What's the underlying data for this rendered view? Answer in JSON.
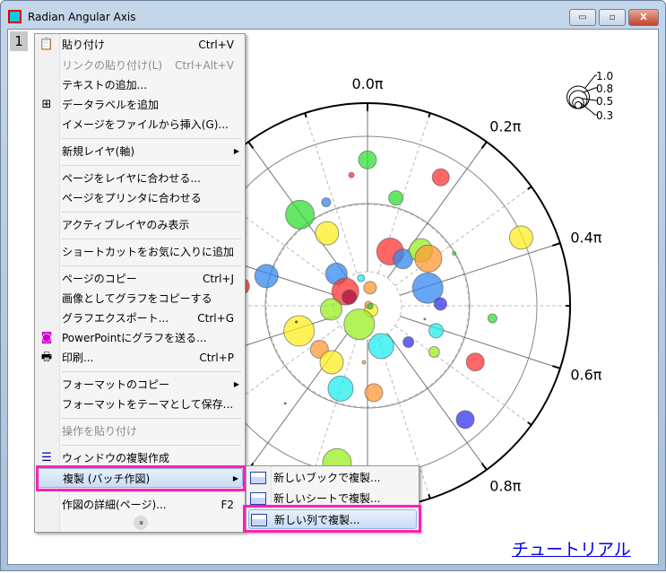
{
  "window": {
    "title": "Radian Angular Axis",
    "layer_label": "1",
    "minimize": "▭",
    "maximize": "▫",
    "close": "X"
  },
  "tutorial_link": "チュートリアル",
  "context_menu": {
    "items": [
      {
        "label": "貼り付け",
        "shortcut": "Ctrl+V",
        "icon": "paste-icon",
        "enabled": true
      },
      {
        "label": "リンクの貼り付け(L)",
        "shortcut": "Ctrl+Alt+V",
        "enabled": false
      },
      {
        "label": "テキストの追加...",
        "enabled": true
      },
      {
        "label": "データラベルを追加",
        "icon": "data-label-icon",
        "enabled": true
      },
      {
        "label": "イメージをファイルから挿入(G)...",
        "enabled": true
      },
      {
        "label": "新規レイヤ(軸)",
        "submenu": true,
        "enabled": true
      },
      {
        "label": "ページをレイヤに合わせる...",
        "enabled": true
      },
      {
        "label": "ページをプリンタに合わせる",
        "enabled": true
      },
      {
        "label": "アクティブレイヤのみ表示",
        "enabled": true
      },
      {
        "label": "ショートカットをお気に入りに追加",
        "enabled": true
      },
      {
        "label": "ページのコピー",
        "shortcut": "Ctrl+J",
        "enabled": true
      },
      {
        "label": "画像としてグラフをコピーする",
        "enabled": true
      },
      {
        "label": "グラフエクスポート...",
        "shortcut": "Ctrl+G",
        "enabled": true
      },
      {
        "label": "PowerPointにグラフを送る...",
        "icon": "powerpoint-icon",
        "enabled": true
      },
      {
        "label": "印刷...",
        "shortcut": "Ctrl+P",
        "icon": "printer-icon",
        "enabled": true
      },
      {
        "label": "フォーマットのコピー",
        "submenu": true,
        "enabled": true
      },
      {
        "label": "フォーマットをテーマとして保存...",
        "enabled": true
      },
      {
        "label": "操作を貼り付け",
        "enabled": false
      },
      {
        "label": "ウィンドウの複製作成",
        "icon": "duplicate-window-icon",
        "enabled": true
      },
      {
        "label": "複製 (バッチ作図)",
        "submenu": true,
        "enabled": true,
        "highlighted": true
      },
      {
        "label": "作図の詳細(ページ)...",
        "shortcut": "F2",
        "enabled": true
      }
    ],
    "more": "»"
  },
  "submenu": {
    "items": [
      {
        "label": "新しいブックで複製...",
        "icon": "new-book-icon"
      },
      {
        "label": "新しいシートで複製...",
        "icon": "new-sheet-icon"
      },
      {
        "label": "新しい列で複製...",
        "icon": "new-column-icon",
        "highlighted": true
      }
    ]
  },
  "colors": {
    "highlight_box": "#ff1fb4",
    "link": "#0000ee"
  },
  "chart_data": {
    "type": "scatter",
    "subtype": "polar-bubble",
    "angle_unit": "π",
    "angle_direction": "clockwise",
    "angle_zero": "top",
    "angle_ticks": [
      "0.0π",
      "0.2π",
      "0.4π",
      "0.6π",
      "0.8π"
    ],
    "angle_tick_values": [
      0,
      0.2,
      0.4,
      0.6,
      0.8
    ],
    "radial_range": [
      0,
      1
    ],
    "grid": true,
    "size_legend": {
      "labels": [
        "1.0",
        "0.8",
        "0.5",
        "0.3"
      ],
      "values": [
        1.0,
        0.8,
        0.5,
        0.3
      ],
      "placement": "top-right"
    },
    "points": [
      {
        "theta": 0,
        "r": 0.72,
        "size": 0.8,
        "color": "#33dd33"
      },
      {
        "theta": 0.165,
        "r": 0.73,
        "size": 0.76,
        "color": "#ff3333"
      },
      {
        "theta": 1.961,
        "r": 0.65,
        "size": 0.24,
        "color": "#ff3333"
      },
      {
        "theta": 0.082,
        "r": 0.55,
        "size": 0.64,
        "color": "#33dd33"
      },
      {
        "theta": 1.879,
        "r": 0.55,
        "size": 0.4,
        "color": "#3388ee"
      },
      {
        "theta": 1.797,
        "r": 0.56,
        "size": 1.28,
        "color": "#33dd33"
      },
      {
        "theta": 1.838,
        "r": 0.41,
        "size": 1.04,
        "color": "#ffee22"
      },
      {
        "theta": 0.367,
        "r": 0.83,
        "size": 1.04,
        "color": "#ffee22"
      },
      {
        "theta": 0.126,
        "r": 0.29,
        "size": 1.2,
        "color": "#ff3333"
      },
      {
        "theta": 0.206,
        "r": 0.29,
        "size": 0.88,
        "color": "#3388ee"
      },
      {
        "theta": 0.244,
        "r": 0.38,
        "size": 1.04,
        "color": "#99ee22"
      },
      {
        "theta": 0.29,
        "r": 0.38,
        "size": 1.2,
        "color": "#ff9933"
      },
      {
        "theta": 0.327,
        "r": 0.5,
        "size": 0.16,
        "color": "#33dd33"
      },
      {
        "theta": 1.591,
        "r": 0.52,
        "size": 1.04,
        "color": "#3388ee"
      },
      {
        "theta": 1.549,
        "r": 0.63,
        "size": 0.72,
        "color": "#ff3333"
      },
      {
        "theta": 1.754,
        "r": 0.22,
        "size": 0.96,
        "color": "#3388ee"
      },
      {
        "theta": 1.927,
        "r": 0.14,
        "size": 0.32,
        "color": "#22eeee"
      },
      {
        "theta": 0.045,
        "r": 0.09,
        "size": 0.56,
        "color": "#ff9933"
      },
      {
        "theta": 0.409,
        "r": 0.31,
        "size": 1.36,
        "color": "#3388ee"
      },
      {
        "theta": 1.681,
        "r": 0.13,
        "size": 1.2,
        "color": "#ff3333"
      },
      {
        "theta": 1.642,
        "r": 0.1,
        "size": 0.64,
        "color": "#aa1144"
      },
      {
        "theta": 0.492,
        "r": 0.36,
        "size": 0.56,
        "color": "#3333ee"
      },
      {
        "theta": 1.469,
        "r": 0.18,
        "size": 0.96,
        "color": "#99ee22"
      },
      {
        "theta": 0.78,
        "r": 0.028,
        "size": 0.6,
        "color": "#ffee22"
      },
      {
        "theta": 0.25,
        "r": 0.006,
        "size": 0.32,
        "color": "#ff9933"
      },
      {
        "theta": 0.56,
        "r": 0.014,
        "size": 0.24,
        "color": "#33dd33"
      },
      {
        "theta": 1.134,
        "r": 0.1,
        "size": 1.36,
        "color": "#99ee22"
      },
      {
        "theta": 0.532,
        "r": 0.62,
        "size": 0.4,
        "color": "#33dd33"
      },
      {
        "theta": 0.573,
        "r": 0.29,
        "size": 0.08,
        "color": "#3355aa"
      },
      {
        "theta": 1.388,
        "r": 0.36,
        "size": 1.36,
        "color": "#ffee22"
      },
      {
        "theta": 0.611,
        "r": 0.36,
        "size": 0.64,
        "color": "#22eeee"
      },
      {
        "theta": 0.896,
        "r": 0.21,
        "size": 1.12,
        "color": "#22eeee"
      },
      {
        "theta": 0.731,
        "r": 0.27,
        "size": 0.48,
        "color": "#3333ee"
      },
      {
        "theta": 1.266,
        "r": 0.32,
        "size": 0.8,
        "color": "#ff9933"
      },
      {
        "theta": 0.693,
        "r": 0.4,
        "size": 0.48,
        "color": "#99ee22"
      },
      {
        "theta": 1.18,
        "r": 0.33,
        "size": 1.04,
        "color": "#ffee22"
      },
      {
        "theta": 1.02,
        "r": 0.28,
        "size": 0.16,
        "color": "#ff9933"
      },
      {
        "theta": 0.653,
        "r": 0.6,
        "size": 0.8,
        "color": "#ff3333"
      },
      {
        "theta": 1.1,
        "r": 0.43,
        "size": 1.12,
        "color": "#22eeee"
      },
      {
        "theta": 0.977,
        "r": 0.43,
        "size": 0.8,
        "color": "#ff9933"
      },
      {
        "theta": 0.774,
        "r": 0.74,
        "size": 0.8,
        "color": "#3333ee"
      },
      {
        "theta": 1.061,
        "r": 0.79,
        "size": 1.28,
        "color": "#99ee22"
      },
      {
        "theta": 1.429,
        "r": 0.36,
        "size": 0.1,
        "color": "#553311"
      },
      {
        "theta": 1.223,
        "r": 0.63,
        "size": 0.08,
        "color": "#333333"
      }
    ]
  }
}
